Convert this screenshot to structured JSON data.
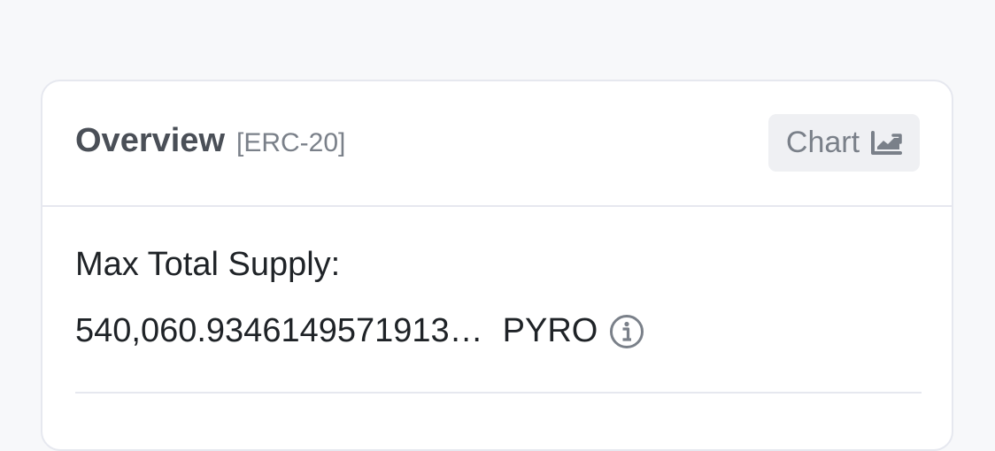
{
  "overview_card": {
    "title": "Overview",
    "token_standard": "[ERC-20]",
    "chart_button": {
      "label": "Chart",
      "icon": "area-chart-icon"
    },
    "max_total_supply": {
      "label": "Max Total Supply:",
      "value": "540,060.9346149571913…",
      "symbol": "PYRO",
      "info_icon": "info-circle-icon"
    }
  },
  "colors": {
    "page_background": "#f7f8fa",
    "card_background": "#ffffff",
    "border": "#e6e8ef",
    "heading_text": "#4a4f57",
    "muted_text": "#7a8089",
    "body_text": "#1f2327",
    "button_background": "#eff0f3"
  }
}
